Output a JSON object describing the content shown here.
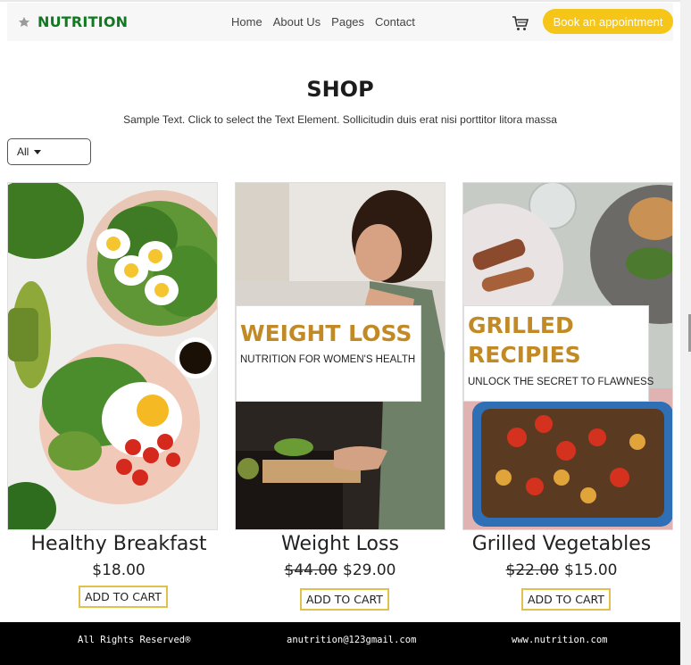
{
  "header": {
    "brand": "NUTRITION",
    "nav": [
      "Home",
      "About Us",
      "Pages",
      "Contact"
    ],
    "book_label": "Book an appointment",
    "accent": "#f5c518",
    "brand_color": "#0f7a1f"
  },
  "shop": {
    "title": "SHOP",
    "subtitle": "Sample Text. Click to select the Text Element. Sollicitudin duis erat nisi porttitor litora massa",
    "filter_value": "All"
  },
  "products": [
    {
      "name": "Healthy Breakfast",
      "price": "$18.00",
      "old_price": "",
      "button": "ADD TO CART"
    },
    {
      "name": "Weight Loss",
      "price": "$29.00",
      "old_price": "$44.00",
      "button": "ADD TO CART",
      "overlay_title": "WEIGHT LOSS",
      "overlay_sub": "NUTRITION FOR WOMEN'S HEALTH"
    },
    {
      "name": "Grilled Vegetables",
      "price": "$15.00",
      "old_price": "$22.00",
      "button": "ADD TO CART",
      "overlay_title_1": "GRILLED",
      "overlay_title_2": "RECIPIES",
      "overlay_sub": "UNLOCK THE SECRET TO FLAWNESS"
    }
  ],
  "footer": {
    "rights": "All Rights Reserved®",
    "email": "anutrition@123gmail.com",
    "website": "www.nutrition.com"
  },
  "icons": [
    "leaf-icon",
    "cart-icon",
    "caret-down-icon"
  ]
}
